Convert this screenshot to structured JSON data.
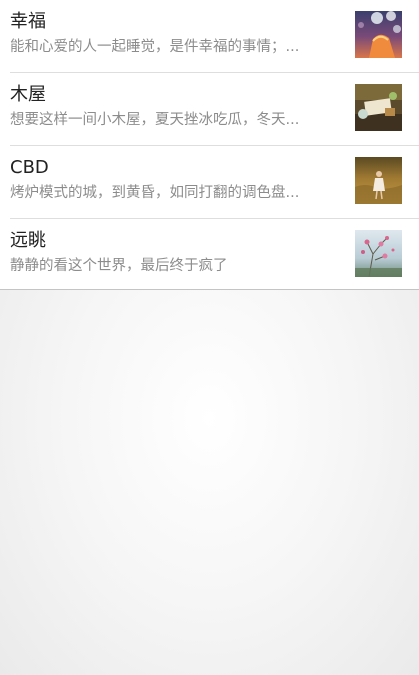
{
  "list": {
    "items": [
      {
        "title": "幸福",
        "description": "能和心爱的人一起睡觉，是件幸福的事情；...",
        "thumbnail": "bokeh-sunset-photo"
      },
      {
        "title": "木屋",
        "description": "想要这样一间小木屋，夏天挫冰吃瓜，冬天...",
        "thumbnail": "wooden-table-photo"
      },
      {
        "title": "CBD",
        "description": "烤炉模式的城，到黄昏，如同打翻的调色盘...",
        "thumbnail": "field-girl-photo"
      },
      {
        "title": "远眺",
        "description": "静静的看这个世界，最后终于疯了",
        "thumbnail": "pink-flowers-photo"
      }
    ]
  }
}
